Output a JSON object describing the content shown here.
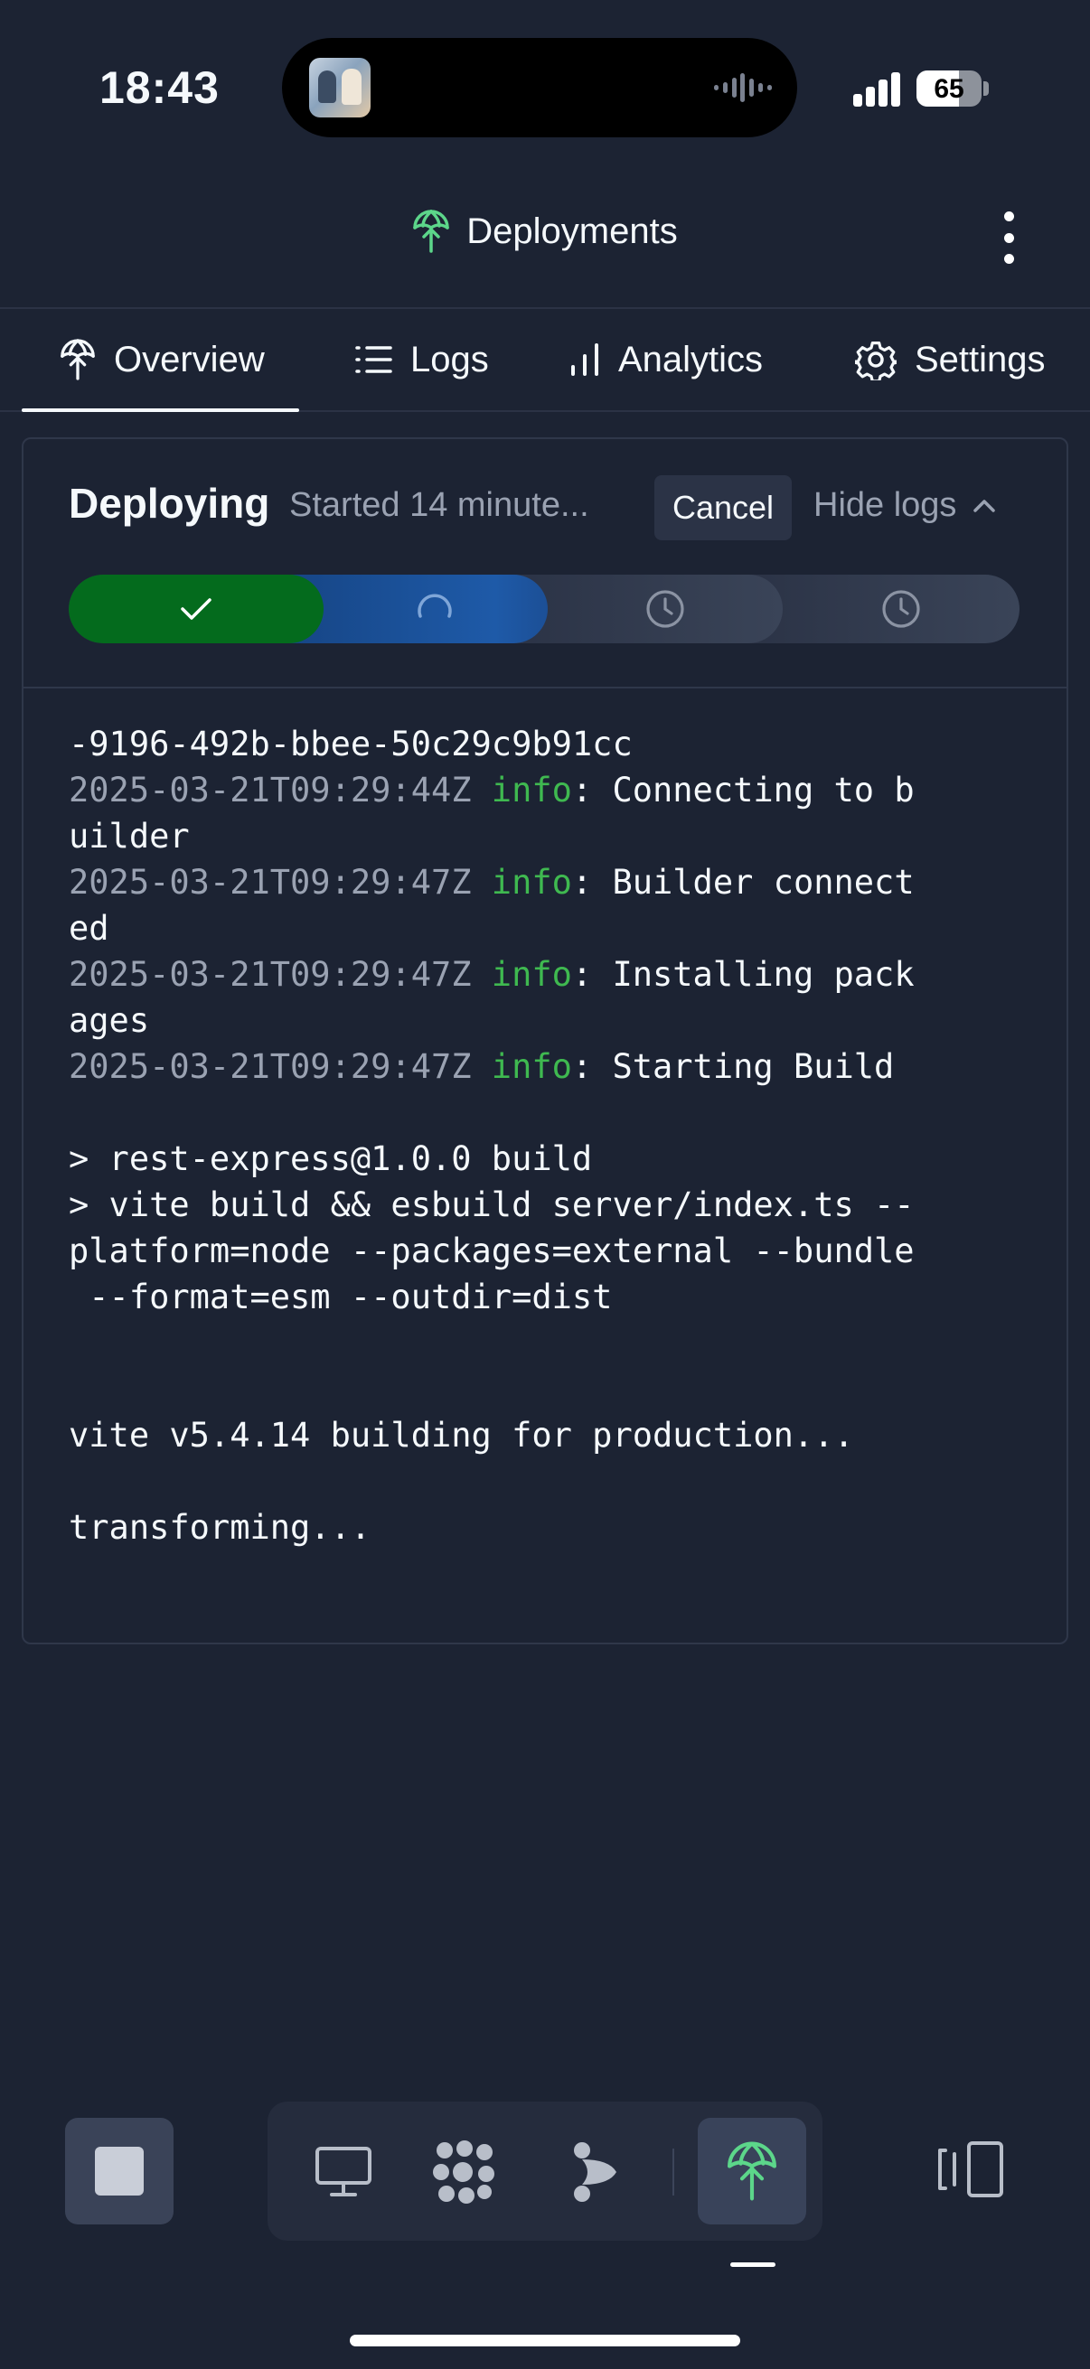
{
  "status": {
    "time": "18:43",
    "battery": "65"
  },
  "header": {
    "title": "Deployments",
    "icon": "deploy-icon",
    "menu_icon": "more-vertical-icon"
  },
  "tabs": [
    {
      "label": "Overview",
      "icon": "deploy-icon",
      "active": true
    },
    {
      "label": "Logs",
      "icon": "list-icon"
    },
    {
      "label": "Analytics",
      "icon": "bar-chart-icon"
    },
    {
      "label": "Settings",
      "icon": "gear-icon"
    }
  ],
  "deployment": {
    "status": "Deploying",
    "started": "Started 14 minute...",
    "cancel_label": "Cancel",
    "hide_logs_label": "Hide logs",
    "steps": [
      {
        "state": "done",
        "icon": "check-icon"
      },
      {
        "state": "in-progress",
        "icon": "spinner-icon"
      },
      {
        "state": "pending",
        "icon": "clock-icon"
      },
      {
        "state": "pending",
        "icon": "clock-icon"
      }
    ]
  },
  "log_lines": [
    {
      "text": "-9196-492b-bbee-50c29c9b91cc"
    },
    {
      "ts": "2025-03-21T09:29:44Z ",
      "level": "info",
      "text": ": Connecting to b"
    },
    {
      "text": "uilder"
    },
    {
      "ts": "2025-03-21T09:29:47Z ",
      "level": "info",
      "text": ": Builder connect"
    },
    {
      "text": "ed"
    },
    {
      "ts": "2025-03-21T09:29:47Z ",
      "level": "info",
      "text": ": Installing pack"
    },
    {
      "text": "ages"
    },
    {
      "ts": "2025-03-21T09:29:47Z ",
      "level": "info",
      "text": ": Starting Build"
    },
    {
      "text": ""
    },
    {
      "text": "> rest-express@1.0.0 build"
    },
    {
      "text": "> vite build && esbuild server/index.ts --"
    },
    {
      "text": "platform=node --packages=external --bundle"
    },
    {
      "text": " --format=esm --outdir=dist"
    },
    {
      "text": ""
    },
    {
      "text": ""
    },
    {
      "text": "vite v5.4.14 building for production..."
    },
    {
      "text": ""
    },
    {
      "text": "transforming..."
    }
  ],
  "bottom_bar": {
    "stop_icon": "stop-icon",
    "dock": [
      "desktop-icon",
      "workspace-icon",
      "agent-icon",
      "deploy-icon"
    ],
    "side_icon": "panel-toggle-icon"
  },
  "colors": {
    "background": "#1c2333",
    "success": "#046b1d",
    "progress": "#1e5aa8",
    "accent_green": "#5cd68a",
    "log_info": "#3fb950",
    "muted": "#9aa2b2"
  }
}
